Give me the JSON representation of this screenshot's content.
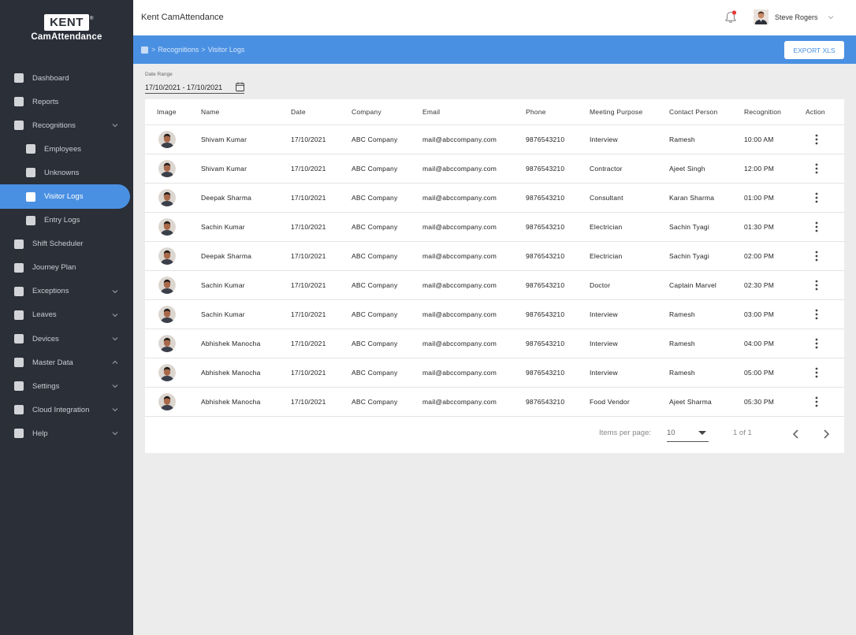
{
  "brand": {
    "logo_text": "KENT",
    "logo_mark": "®",
    "product": "CamAttendance"
  },
  "sidebar": {
    "items": [
      {
        "label": "Dashboard",
        "level": 0,
        "chevron": ""
      },
      {
        "label": "Reports",
        "level": 0,
        "chevron": ""
      },
      {
        "label": "Recognitions",
        "level": 0,
        "chevron": "down"
      },
      {
        "label": "Employees",
        "level": 1,
        "chevron": ""
      },
      {
        "label": "Unknowns",
        "level": 1,
        "chevron": ""
      },
      {
        "label": "Visitor Logs",
        "level": 1,
        "chevron": "",
        "active": true
      },
      {
        "label": "Entry Logs",
        "level": 1,
        "chevron": ""
      },
      {
        "label": "Shift Scheduler",
        "level": 0,
        "chevron": ""
      },
      {
        "label": "Journey Plan",
        "level": 0,
        "chevron": ""
      },
      {
        "label": "Exceptions",
        "level": 0,
        "chevron": "down"
      },
      {
        "label": "Leaves",
        "level": 0,
        "chevron": "down"
      },
      {
        "label": "Devices",
        "level": 0,
        "chevron": "down"
      },
      {
        "label": "Master Data",
        "level": 0,
        "chevron": "up"
      },
      {
        "label": "Settings",
        "level": 0,
        "chevron": "down"
      },
      {
        "label": "Cloud Integration",
        "level": 0,
        "chevron": "down"
      },
      {
        "label": "Help",
        "level": 0,
        "chevron": "down"
      }
    ]
  },
  "header": {
    "title": "Kent CamAttendance",
    "user_name": "Steve Rogers",
    "notification_dot_color": "#e53935"
  },
  "breadcrumb": {
    "items": [
      "Recognitions",
      "Visitor Logs"
    ],
    "separator": ">"
  },
  "toolbar": {
    "export_label": "EXPORT XLS"
  },
  "filter": {
    "date_label": "Date Range",
    "date_value": "17/10/2021 - 17/10/2021"
  },
  "table": {
    "columns": [
      "Image",
      "Name",
      "Date",
      "Company",
      "Email",
      "Phone",
      "Meeting Purpose",
      "Contact Person",
      "Recognition",
      "Action"
    ],
    "rows": [
      {
        "name": "Shivam Kumar",
        "date": "17/10/2021",
        "company": "ABC Company",
        "email": "mail@abccompany.com",
        "phone": "9876543210",
        "purpose": "Interview",
        "contact": "Ramesh",
        "time": "10:00 AM"
      },
      {
        "name": "Shivam Kumar",
        "date": "17/10/2021",
        "company": "ABC Company",
        "email": "mail@abccompany.com",
        "phone": "9876543210",
        "purpose": "Contractor",
        "contact": "Ajeet Singh",
        "time": "12:00 PM"
      },
      {
        "name": "Deepak Sharma",
        "date": "17/10/2021",
        "company": "ABC Company",
        "email": "mail@abccompany.com",
        "phone": "9876543210",
        "purpose": "Consultant",
        "contact": "Karan Sharma",
        "time": "01:00 PM"
      },
      {
        "name": "Sachin Kumar",
        "date": "17/10/2021",
        "company": "ABC Company",
        "email": "mail@abccompany.com",
        "phone": "9876543210",
        "purpose": "Electrician",
        "contact": "Sachin Tyagi",
        "time": "01:30 PM"
      },
      {
        "name": "Deepak Sharma",
        "date": "17/10/2021",
        "company": "ABC Company",
        "email": "mail@abccompany.com",
        "phone": "9876543210",
        "purpose": "Electrician",
        "contact": "Sachin Tyagi",
        "time": "02:00 PM"
      },
      {
        "name": "Sachin Kumar",
        "date": "17/10/2021",
        "company": "ABC Company",
        "email": "mail@abccompany.com",
        "phone": "9876543210",
        "purpose": "Doctor",
        "contact": "Captain Marvel",
        "time": "02:30 PM"
      },
      {
        "name": "Sachin Kumar",
        "date": "17/10/2021",
        "company": "ABC Company",
        "email": "mail@abccompany.com",
        "phone": "9876543210",
        "purpose": "Interview",
        "contact": "Ramesh",
        "time": "03:00 PM"
      },
      {
        "name": "Abhishek Manocha",
        "date": "17/10/2021",
        "company": "ABC Company",
        "email": "mail@abccompany.com",
        "phone": "9876543210",
        "purpose": "Interview",
        "contact": "Ramesh",
        "time": "04:00 PM"
      },
      {
        "name": "Abhishek Manocha",
        "date": "17/10/2021",
        "company": "ABC Company",
        "email": "mail@abccompany.com",
        "phone": "9876543210",
        "purpose": "Interview",
        "contact": "Ramesh",
        "time": "05:00 PM"
      },
      {
        "name": "Abhishek Manocha",
        "date": "17/10/2021",
        "company": "ABC Company",
        "email": "mail@abccompany.com",
        "phone": "9876543210",
        "purpose": "Food Vendor",
        "contact": "Ajeet Sharma",
        "time": "05:30 PM"
      }
    ]
  },
  "pagination": {
    "items_per_page_label": "Items per page:",
    "items_per_page": "10",
    "range": "1 of 1"
  },
  "colors": {
    "accent": "#4a90e2",
    "sidebar_bg": "#2b2f38",
    "page_bg": "#ececec"
  },
  "icons": {
    "bell": "bell-icon",
    "calendar": "calendar-icon",
    "kebab": "more-vertical-icon",
    "chevron": "chevron-down-icon",
    "prev": "chevron-left-icon",
    "next": "chevron-right-icon",
    "home": "home-icon"
  }
}
